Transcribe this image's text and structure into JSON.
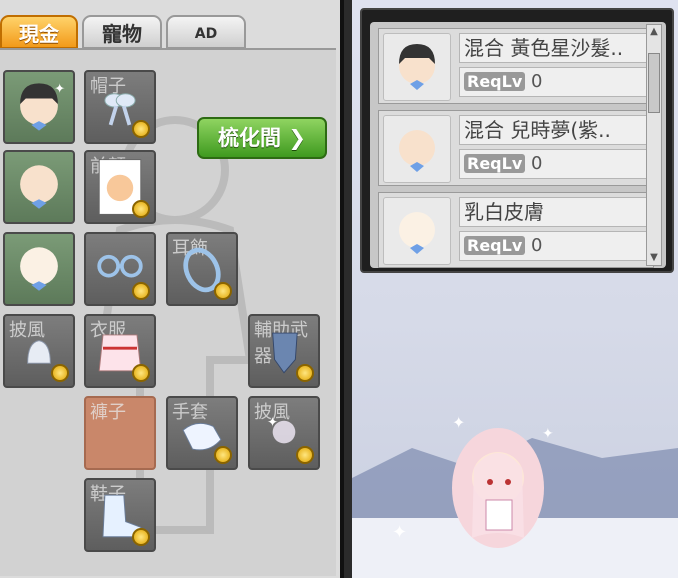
{
  "tabs": {
    "cash": "現金",
    "pet": "寵物",
    "ad": "AD"
  },
  "equip": {
    "cleanse_button": "梳化間",
    "slot_labels": {
      "hat": "帽子",
      "face_acc": "前額",
      "earring": "耳飾",
      "cape": "披風",
      "overall": "衣服",
      "secondary": "輔助武器",
      "pants": "褲子",
      "gloves": "手套",
      "shield": "披風",
      "shoes": "鞋子"
    }
  },
  "list": {
    "items": [
      {
        "name": "混合 黃色星沙髮..",
        "req_label": "ReqLv",
        "req_value": "0"
      },
      {
        "name": "混合 兒時夢(紫..",
        "req_label": "ReqLv",
        "req_value": "0"
      },
      {
        "name": "乳白皮膚",
        "req_label": "ReqLv",
        "req_value": "0"
      }
    ]
  },
  "colors": {
    "tab_active": "#f29a1a",
    "button_green": "#4fa82a"
  }
}
